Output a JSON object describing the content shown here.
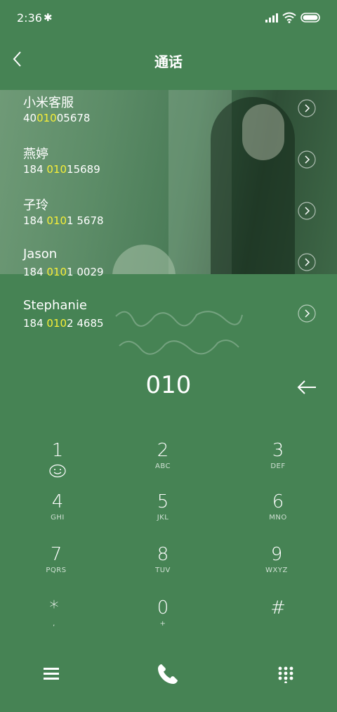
{
  "status_bar": {
    "time": "2:36"
  },
  "header": {
    "title": "通话"
  },
  "contacts": [
    {
      "name": "小米客服",
      "number_pre": "40",
      "number_match": "010",
      "number_post": "05678"
    },
    {
      "name": "燕婷",
      "number_pre": "184 ",
      "number_match": "010",
      "number_post": "15689"
    },
    {
      "name": "子玲",
      "number_pre": "184 ",
      "number_match": "010",
      "number_post": "1 5678"
    },
    {
      "name": "Jason",
      "number_pre": "184 ",
      "number_match": "010",
      "number_post": "1 0029"
    },
    {
      "name": "Stephanie",
      "number_pre": "184 ",
      "number_match": "010",
      "number_post": "2 4685"
    }
  ],
  "dial": {
    "input": "010"
  },
  "keypad": [
    {
      "digit": "1",
      "letters": ""
    },
    {
      "digit": "2",
      "letters": "ABC"
    },
    {
      "digit": "3",
      "letters": "DEF"
    },
    {
      "digit": "4",
      "letters": "GHI"
    },
    {
      "digit": "5",
      "letters": "JKL"
    },
    {
      "digit": "6",
      "letters": "MNO"
    },
    {
      "digit": "7",
      "letters": "PQRS"
    },
    {
      "digit": "8",
      "letters": "TUV"
    },
    {
      "digit": "9",
      "letters": "WXYZ"
    },
    {
      "digit": "*",
      "letters": ","
    },
    {
      "digit": "0",
      "letters": "+"
    },
    {
      "digit": "#",
      "letters": ""
    }
  ],
  "colors": {
    "background": "#468354",
    "highlight": "#f7ef38"
  }
}
